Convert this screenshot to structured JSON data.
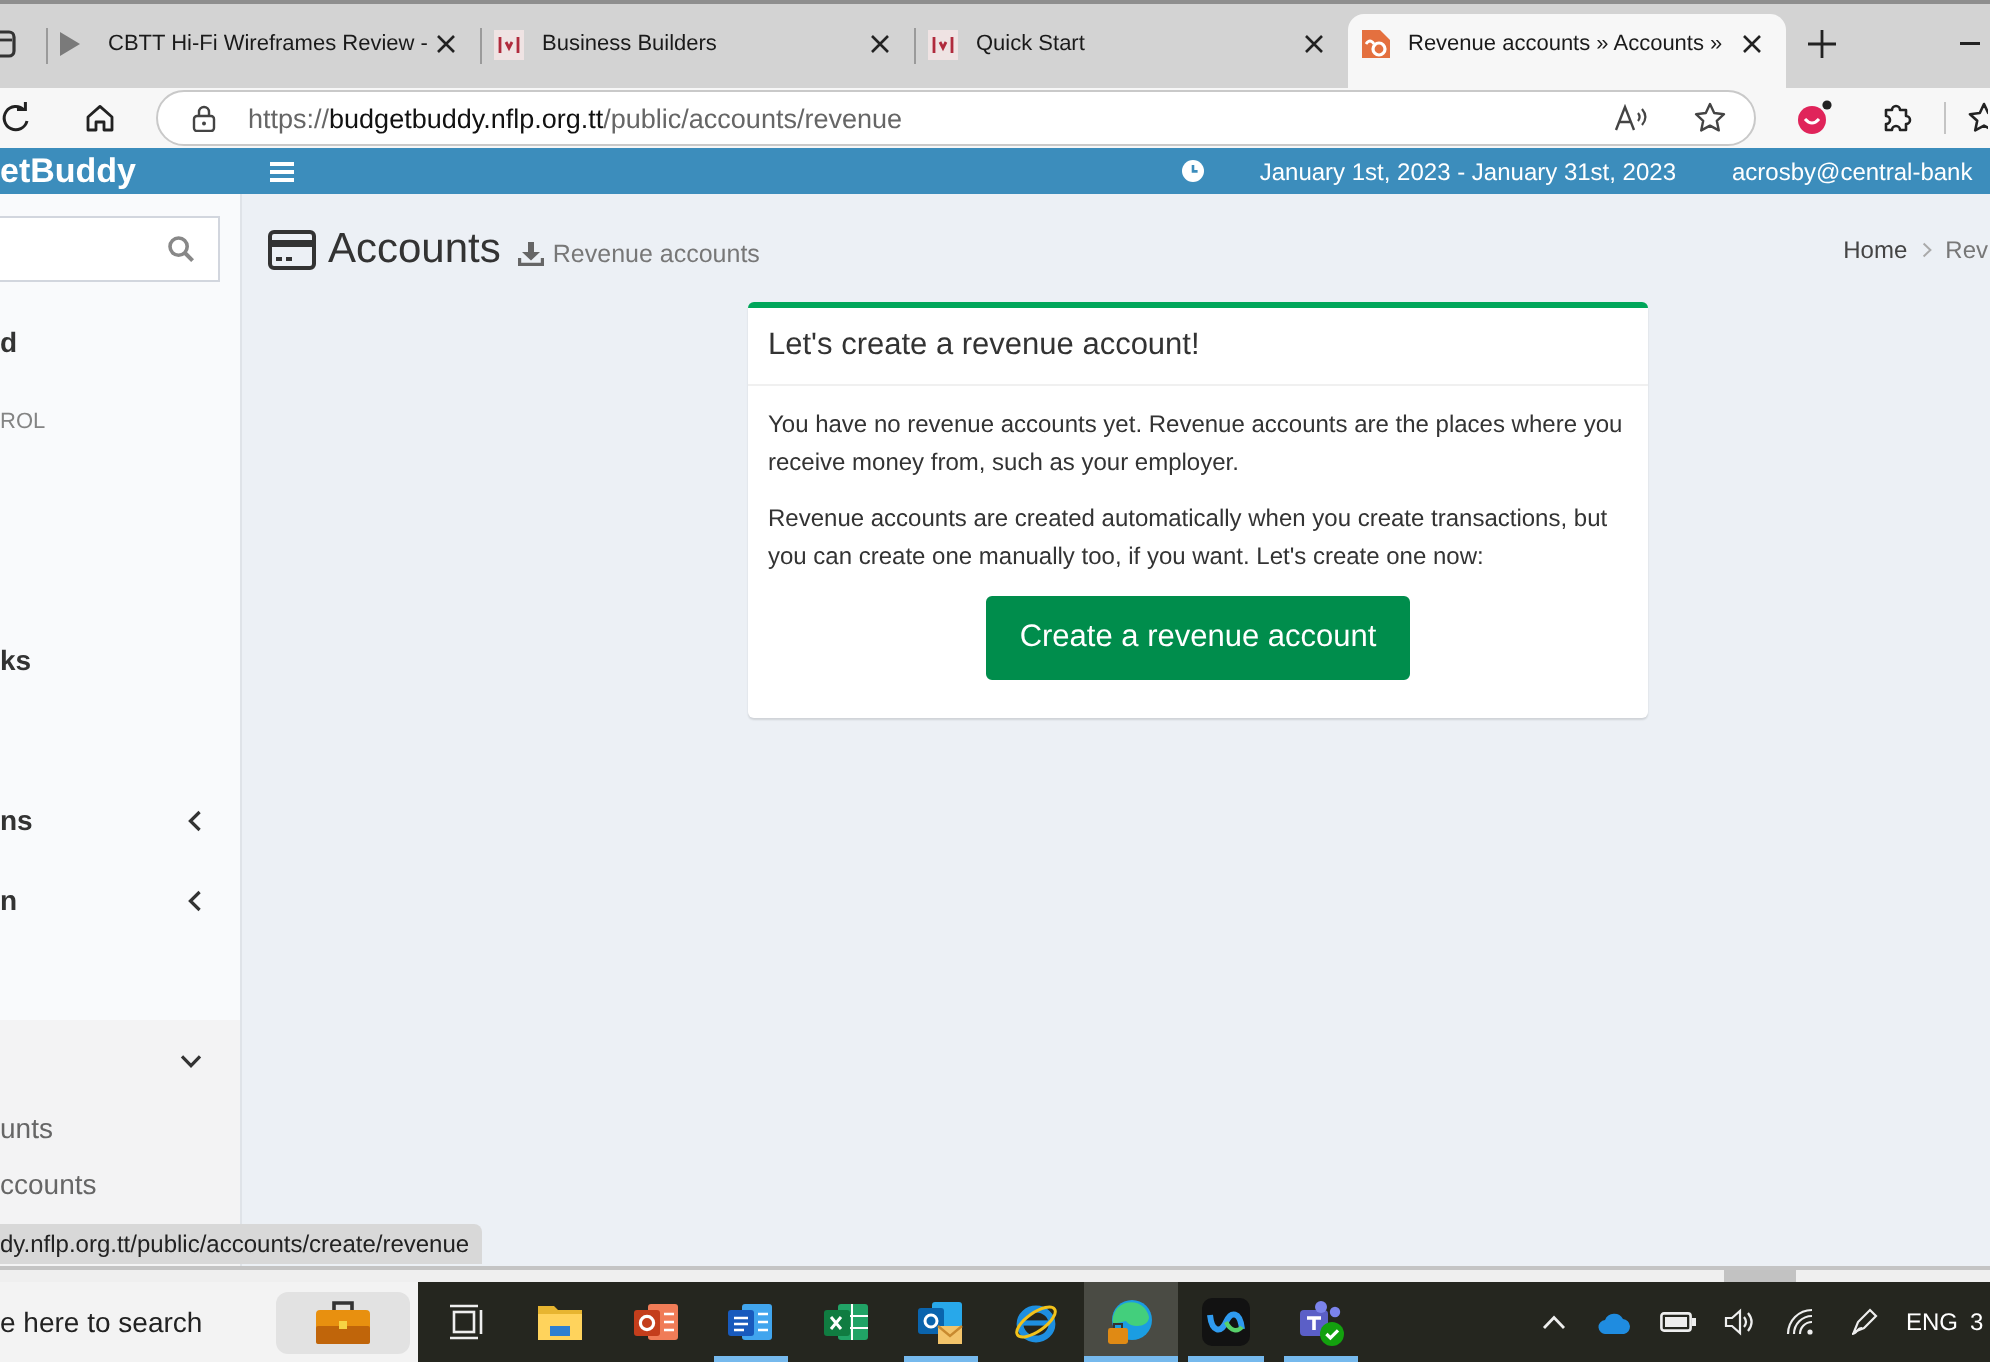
{
  "browser": {
    "tabs": [
      {
        "kind": "media",
        "title": "CBTT Hi-Fi Wireframes Review -",
        "selected": false
      },
      {
        "kind": "site",
        "title": "Business Builders",
        "selected": false
      },
      {
        "kind": "site",
        "title": "Quick Start",
        "selected": false
      },
      {
        "kind": "app",
        "title": "Revenue accounts » Accounts »",
        "selected": true
      }
    ],
    "address": {
      "scheme": "https://",
      "host": "budgetbuddy.nflp.org.tt",
      "path": "/public/accounts/revenue"
    },
    "status_url": "dy.nflp.org.tt/public/accounts/create/revenue"
  },
  "app_header": {
    "logo": "etBuddy",
    "date_range": "January 1st, 2023 - January 31st, 2023",
    "user": "acrosby@central-bank"
  },
  "sidebar": {
    "items": [
      {
        "kind": "link",
        "label": "d"
      },
      {
        "kind": "header",
        "label": "ROL"
      },
      {
        "kind": "link",
        "label": "ks"
      },
      {
        "kind": "tree",
        "label": "ns",
        "expanded": false
      },
      {
        "kind": "tree",
        "label": "n",
        "expanded": false
      },
      {
        "kind": "tree",
        "expanded": true,
        "children": [
          {
            "label": "unts"
          },
          {
            "label": "ccounts"
          }
        ]
      }
    ]
  },
  "content": {
    "title": "Accounts",
    "subtitle": "Revenue accounts",
    "breadcrumb": [
      "Home",
      "Rev"
    ],
    "card": {
      "title": "Let's create a revenue account!",
      "paragraphs": [
        "You have no revenue accounts yet. Revenue accounts are the places where you receive money from, such as your employer.",
        "Revenue accounts are created automatically when you create transactions, but you can create one manually too, if you want. Let's create one now:"
      ],
      "button": "Create a revenue account"
    }
  },
  "taskbar": {
    "search": {
      "placeholder": "e here to search"
    },
    "apps": [
      {
        "kind": "files",
        "running": false,
        "selected": false
      },
      {
        "kind": "slides",
        "running": false,
        "selected": false
      },
      {
        "kind": "document",
        "running": true,
        "selected": false
      },
      {
        "kind": "spreadsheet",
        "running": false,
        "selected": false
      },
      {
        "kind": "mail",
        "running": true,
        "selected": false
      },
      {
        "kind": "legacy_browser",
        "running": false,
        "selected": false
      },
      {
        "kind": "browser",
        "running": true,
        "selected": true
      },
      {
        "kind": "meetings",
        "running": true,
        "selected": false
      },
      {
        "kind": "chat",
        "running": true,
        "selected": false
      }
    ],
    "tray": {
      "language": "ENG",
      "clock": "3"
    }
  }
}
